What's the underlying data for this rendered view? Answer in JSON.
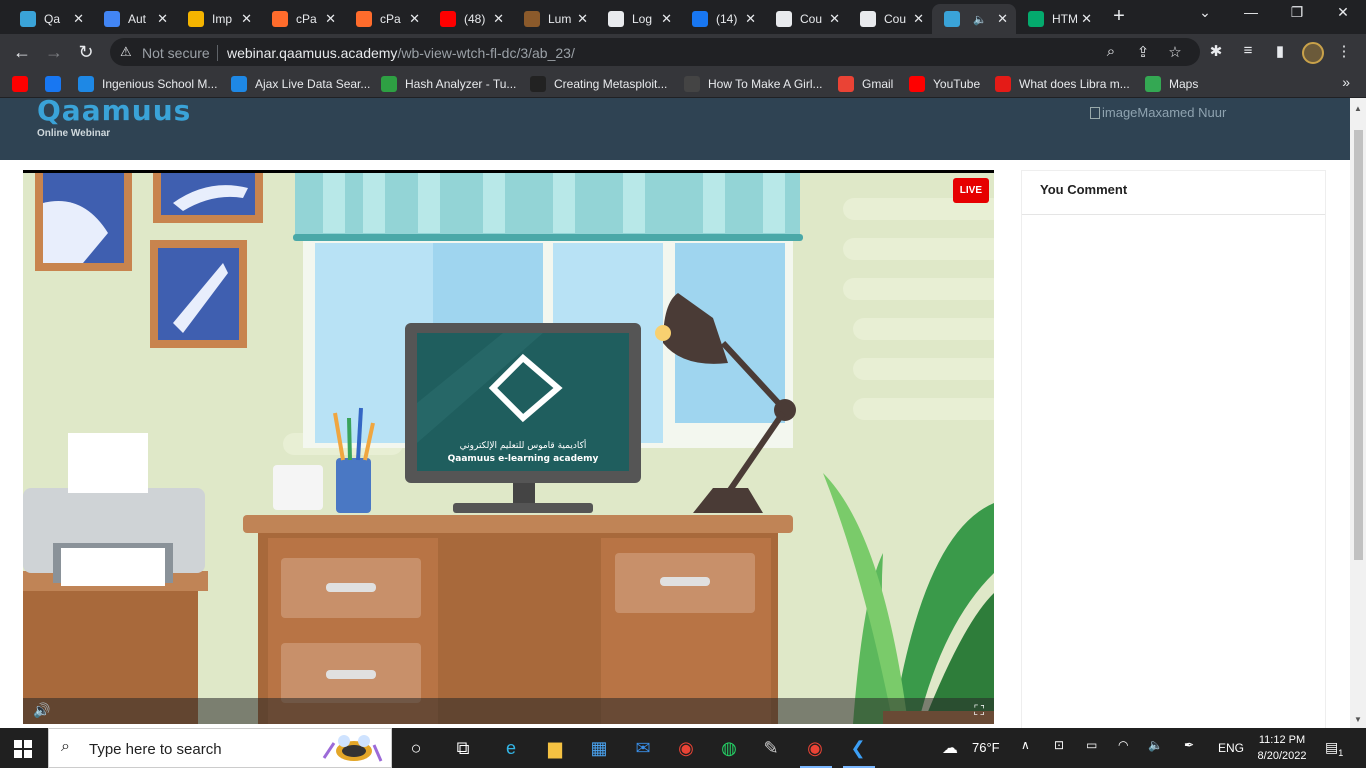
{
  "tabs": [
    {
      "title": "Qa",
      "icon": "qaamuus-icon",
      "color": "#3aa3d8"
    },
    {
      "title": "Aut",
      "icon": "chrome-icon",
      "color": "#4285f4"
    },
    {
      "title": "Imp",
      "icon": "sparkle-icon",
      "color": "#f4b400"
    },
    {
      "title": "cPa",
      "icon": "cpanel-icon",
      "color": "#ff6c2c"
    },
    {
      "title": "cPa",
      "icon": "cpanel-icon",
      "color": "#ff6c2c"
    },
    {
      "title": "(48)",
      "icon": "youtube-icon",
      "color": "#ff0000"
    },
    {
      "title": "Lum",
      "icon": "book-icon",
      "color": "#8b5a2b"
    },
    {
      "title": "Log",
      "icon": "globe-icon",
      "color": "#e8eaed"
    },
    {
      "title": "(14)",
      "icon": "facebook-icon",
      "color": "#1877f2"
    },
    {
      "title": "Cou",
      "icon": "globe-icon",
      "color": "#e8eaed"
    },
    {
      "title": "Cou",
      "icon": "globe-icon",
      "color": "#e8eaed"
    },
    {
      "title": "",
      "icon": "qaamuus-icon",
      "color": "#3aa3d8",
      "active": true
    },
    {
      "title": "HTM",
      "icon": "w3schools-icon",
      "color": "#04aa6d"
    }
  ],
  "address": {
    "security": "Not secure",
    "domain": "webinar.qaamuus.academy",
    "path": "/wb-view-wtch-fl-dc/3/ab_23/"
  },
  "bookmarks": [
    {
      "label": "",
      "icon": "youtube-icon",
      "color": "#ff0000"
    },
    {
      "label": "",
      "icon": "facebook-icon",
      "color": "#1877f2"
    },
    {
      "label": "Ingenious School M...",
      "icon": "code-icon",
      "color": "#1e88e5"
    },
    {
      "label": "Ajax Live Data Sear...",
      "icon": "w-icon",
      "color": "#1e88e5"
    },
    {
      "label": "Hash Analyzer - Tu...",
      "icon": "hash-icon",
      "color": "#2ea043"
    },
    {
      "label": "Creating Metasploit...",
      "icon": "person-icon",
      "color": "#222"
    },
    {
      "label": "How To Make A Girl...",
      "icon": "b-icon",
      "color": "#444"
    },
    {
      "label": "Gmail",
      "icon": "gmail-icon",
      "color": "#ea4335"
    },
    {
      "label": "YouTube",
      "icon": "youtube-icon",
      "color": "#ff0000"
    },
    {
      "label": "What does Libra m...",
      "icon": "cw-icon",
      "color": "#e41b17"
    },
    {
      "label": "Maps",
      "icon": "maps-icon",
      "color": "#34a853"
    }
  ],
  "site": {
    "logo": "Qaamuus",
    "logo_sub": "Online Webinar",
    "user_img_alt": "image",
    "user_name": "Maxamed Nuur"
  },
  "video": {
    "live_badge": "LIVE",
    "screen_text_ar": "أكاديمية قاموس للتعليم الإلكتروني",
    "screen_text_en": "Qaamuus e-learning academy"
  },
  "comments": {
    "title": "You Comment"
  },
  "taskbar": {
    "search_placeholder": "Type here to search",
    "weather": "76°F",
    "lang": "ENG",
    "time": "11:12 PM",
    "date": "8/20/2022",
    "notifications": "1"
  }
}
